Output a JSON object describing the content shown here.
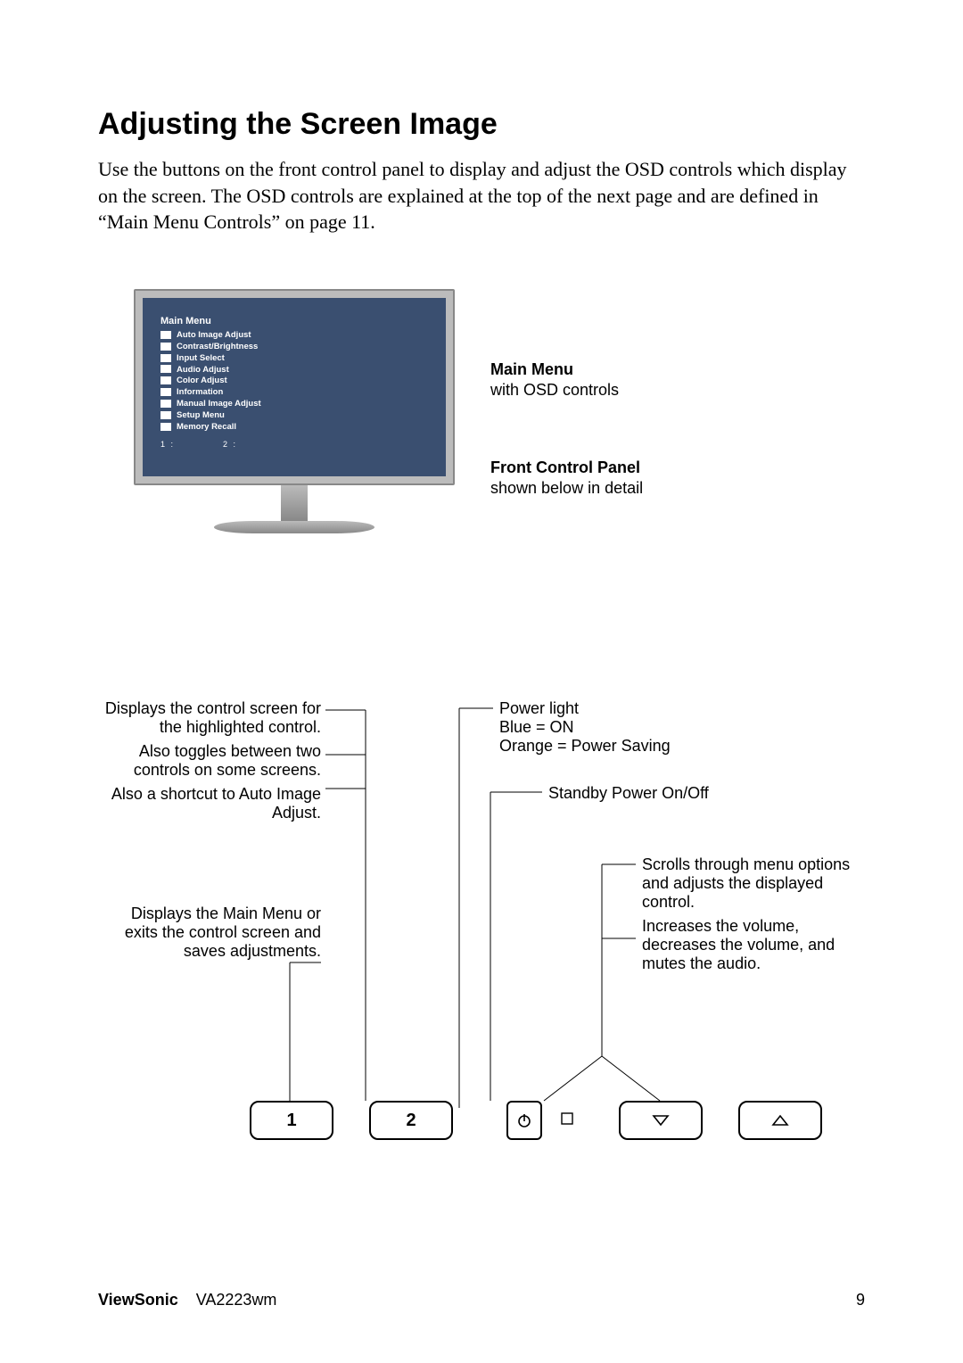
{
  "title": "Adjusting the Screen Image",
  "intro": "Use the buttons on the front control panel to display and adjust the OSD controls which display on the screen. The OSD controls are explained at the top of the next page and are defined in “Main Menu Controls” on page 11.",
  "osd": {
    "title": "Main Menu",
    "items": [
      "Auto Image Adjust",
      "Contrast/Brightness",
      "Input Select",
      "Audio Adjust",
      "Color Adjust",
      "Information",
      "Manual Image Adjust",
      "Setup Menu",
      "Memory Recall"
    ],
    "footer_left": "1 :",
    "footer_right": "2 :"
  },
  "captions": {
    "main_menu_bold": "Main Menu",
    "main_menu_sub": "with OSD controls",
    "fcp_bold": "Front Control Panel",
    "fcp_sub": "shown below in detail"
  },
  "left_labels": {
    "btn2_a": "Displays the control screen for the highlighted control.",
    "btn2_b": "Also toggles between two controls on some screens.",
    "btn2_c": "Also a shortcut to Auto Image Adjust.",
    "btn1": "Displays the Main Menu or exits the control screen and saves adjustments."
  },
  "right_labels": {
    "power_light_a": "Power light",
    "power_light_b": "Blue = ON",
    "power_light_c": "Orange = Power Saving",
    "standby": "Standby Power On/Off",
    "arrows_a": "Scrolls through menu options and adjusts the displayed control.",
    "arrows_b": "Increases the volume, decreases the volume, and mutes the audio."
  },
  "buttons": {
    "b1": "1",
    "b2": "2"
  },
  "footer": {
    "brand": "ViewSonic",
    "model": "VA2223wm",
    "page": "9"
  }
}
